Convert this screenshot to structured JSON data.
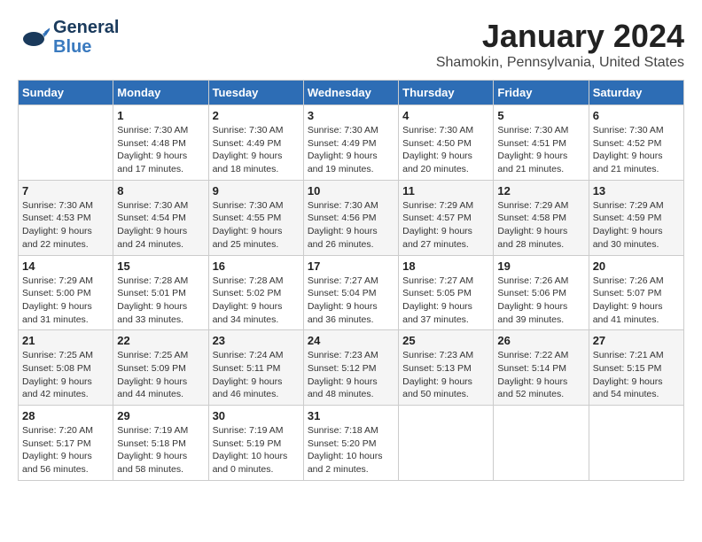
{
  "header": {
    "logo_line1": "General",
    "logo_line2": "Blue",
    "month_title": "January 2024",
    "subtitle": "Shamokin, Pennsylvania, United States"
  },
  "days_of_week": [
    "Sunday",
    "Monday",
    "Tuesday",
    "Wednesday",
    "Thursday",
    "Friday",
    "Saturday"
  ],
  "weeks": [
    [
      {
        "day": "",
        "info": ""
      },
      {
        "day": "1",
        "info": "Sunrise: 7:30 AM\nSunset: 4:48 PM\nDaylight: 9 hours\nand 17 minutes."
      },
      {
        "day": "2",
        "info": "Sunrise: 7:30 AM\nSunset: 4:49 PM\nDaylight: 9 hours\nand 18 minutes."
      },
      {
        "day": "3",
        "info": "Sunrise: 7:30 AM\nSunset: 4:49 PM\nDaylight: 9 hours\nand 19 minutes."
      },
      {
        "day": "4",
        "info": "Sunrise: 7:30 AM\nSunset: 4:50 PM\nDaylight: 9 hours\nand 20 minutes."
      },
      {
        "day": "5",
        "info": "Sunrise: 7:30 AM\nSunset: 4:51 PM\nDaylight: 9 hours\nand 21 minutes."
      },
      {
        "day": "6",
        "info": "Sunrise: 7:30 AM\nSunset: 4:52 PM\nDaylight: 9 hours\nand 21 minutes."
      }
    ],
    [
      {
        "day": "7",
        "info": "Sunrise: 7:30 AM\nSunset: 4:53 PM\nDaylight: 9 hours\nand 22 minutes."
      },
      {
        "day": "8",
        "info": "Sunrise: 7:30 AM\nSunset: 4:54 PM\nDaylight: 9 hours\nand 24 minutes."
      },
      {
        "day": "9",
        "info": "Sunrise: 7:30 AM\nSunset: 4:55 PM\nDaylight: 9 hours\nand 25 minutes."
      },
      {
        "day": "10",
        "info": "Sunrise: 7:30 AM\nSunset: 4:56 PM\nDaylight: 9 hours\nand 26 minutes."
      },
      {
        "day": "11",
        "info": "Sunrise: 7:29 AM\nSunset: 4:57 PM\nDaylight: 9 hours\nand 27 minutes."
      },
      {
        "day": "12",
        "info": "Sunrise: 7:29 AM\nSunset: 4:58 PM\nDaylight: 9 hours\nand 28 minutes."
      },
      {
        "day": "13",
        "info": "Sunrise: 7:29 AM\nSunset: 4:59 PM\nDaylight: 9 hours\nand 30 minutes."
      }
    ],
    [
      {
        "day": "14",
        "info": "Sunrise: 7:29 AM\nSunset: 5:00 PM\nDaylight: 9 hours\nand 31 minutes."
      },
      {
        "day": "15",
        "info": "Sunrise: 7:28 AM\nSunset: 5:01 PM\nDaylight: 9 hours\nand 33 minutes."
      },
      {
        "day": "16",
        "info": "Sunrise: 7:28 AM\nSunset: 5:02 PM\nDaylight: 9 hours\nand 34 minutes."
      },
      {
        "day": "17",
        "info": "Sunrise: 7:27 AM\nSunset: 5:04 PM\nDaylight: 9 hours\nand 36 minutes."
      },
      {
        "day": "18",
        "info": "Sunrise: 7:27 AM\nSunset: 5:05 PM\nDaylight: 9 hours\nand 37 minutes."
      },
      {
        "day": "19",
        "info": "Sunrise: 7:26 AM\nSunset: 5:06 PM\nDaylight: 9 hours\nand 39 minutes."
      },
      {
        "day": "20",
        "info": "Sunrise: 7:26 AM\nSunset: 5:07 PM\nDaylight: 9 hours\nand 41 minutes."
      }
    ],
    [
      {
        "day": "21",
        "info": "Sunrise: 7:25 AM\nSunset: 5:08 PM\nDaylight: 9 hours\nand 42 minutes."
      },
      {
        "day": "22",
        "info": "Sunrise: 7:25 AM\nSunset: 5:09 PM\nDaylight: 9 hours\nand 44 minutes."
      },
      {
        "day": "23",
        "info": "Sunrise: 7:24 AM\nSunset: 5:11 PM\nDaylight: 9 hours\nand 46 minutes."
      },
      {
        "day": "24",
        "info": "Sunrise: 7:23 AM\nSunset: 5:12 PM\nDaylight: 9 hours\nand 48 minutes."
      },
      {
        "day": "25",
        "info": "Sunrise: 7:23 AM\nSunset: 5:13 PM\nDaylight: 9 hours\nand 50 minutes."
      },
      {
        "day": "26",
        "info": "Sunrise: 7:22 AM\nSunset: 5:14 PM\nDaylight: 9 hours\nand 52 minutes."
      },
      {
        "day": "27",
        "info": "Sunrise: 7:21 AM\nSunset: 5:15 PM\nDaylight: 9 hours\nand 54 minutes."
      }
    ],
    [
      {
        "day": "28",
        "info": "Sunrise: 7:20 AM\nSunset: 5:17 PM\nDaylight: 9 hours\nand 56 minutes."
      },
      {
        "day": "29",
        "info": "Sunrise: 7:19 AM\nSunset: 5:18 PM\nDaylight: 9 hours\nand 58 minutes."
      },
      {
        "day": "30",
        "info": "Sunrise: 7:19 AM\nSunset: 5:19 PM\nDaylight: 10 hours\nand 0 minutes."
      },
      {
        "day": "31",
        "info": "Sunrise: 7:18 AM\nSunset: 5:20 PM\nDaylight: 10 hours\nand 2 minutes."
      },
      {
        "day": "",
        "info": ""
      },
      {
        "day": "",
        "info": ""
      },
      {
        "day": "",
        "info": ""
      }
    ]
  ]
}
